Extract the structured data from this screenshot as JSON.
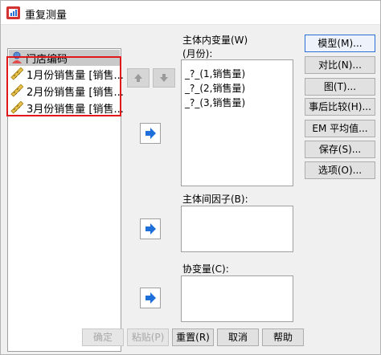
{
  "window": {
    "title": "重复测量"
  },
  "source_list": {
    "items": [
      {
        "label": "门店编码",
        "icon": "nominal-person-icon",
        "selected": true
      },
      {
        "label": "1月份销售量 [销售...",
        "icon": "ruler-scale-icon"
      },
      {
        "label": "2月份销售量 [销售...",
        "icon": "ruler-scale-icon"
      },
      {
        "label": "3月份销售量 [销售...",
        "icon": "ruler-scale-icon"
      }
    ]
  },
  "within_subjects": {
    "label": "主体内变量(W)",
    "sub_label": "(月份):",
    "items": [
      "_?_(1,销售量)",
      "_?_(2,销售量)",
      "_?_(3,销售量)"
    ]
  },
  "between_subjects": {
    "label": "主体间因子(B):"
  },
  "covariates": {
    "label": "协变量(C):"
  },
  "side_buttons": [
    "模型(M)...",
    "对比(N)...",
    "图(T)...",
    "事后比较(H)...",
    "EM 平均值...",
    "保存(S)...",
    "选项(O)..."
  ],
  "bottom_buttons": {
    "ok": "确定",
    "paste": "粘贴(P)",
    "reset": "重置(R)",
    "cancel": "取消",
    "help": "帮助"
  },
  "colors": {
    "highlight": "#e0181b",
    "arrow": "#1e6fd9",
    "button_focus_border": "#2a6fd6"
  }
}
